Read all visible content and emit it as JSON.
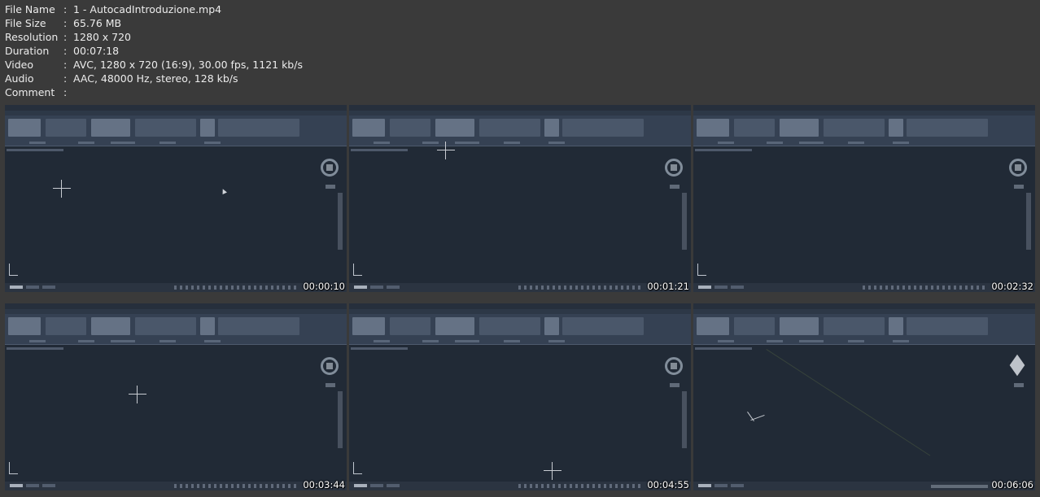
{
  "info": [
    {
      "key": "File Name",
      "sep": ":",
      "value": "1 - AutocadIntroduzione.mp4"
    },
    {
      "key": "File Size",
      "sep": ":",
      "value": "65.76 MB"
    },
    {
      "key": "Resolution",
      "sep": ":",
      "value": "1280 x 720"
    },
    {
      "key": "Duration",
      "sep": ":",
      "value": "00:07:18"
    },
    {
      "key": "Video",
      "sep": ":",
      "value": "AVC, 1280 x 720 (16:9), 30.00 fps, 1121 kb/s"
    },
    {
      "key": "Audio",
      "sep": ":",
      "value": "AAC, 48000 Hz, stereo, 128 kb/s"
    },
    {
      "key": "Comment",
      "sep": ":",
      "value": ""
    }
  ],
  "thumbnails": [
    {
      "timestamp": "00:00:10",
      "variant": "2d"
    },
    {
      "timestamp": "00:01:21",
      "variant": "2d"
    },
    {
      "timestamp": "00:02:32",
      "variant": "2d"
    },
    {
      "timestamp": "00:03:44",
      "variant": "2d"
    },
    {
      "timestamp": "00:04:55",
      "variant": "2d"
    },
    {
      "timestamp": "00:06:06",
      "variant": "3d"
    }
  ],
  "icons": {
    "navigation": "navigation-wheel-icon",
    "viewcube": "viewcube-icon",
    "crosshair": "crosshair-cursor-icon",
    "ucs": "ucs-axis-icon"
  },
  "colors": {
    "sheet_background": "#3a3a3a",
    "canvas_background": "#212a36",
    "ribbon": "#354153",
    "text": "#ececec"
  }
}
